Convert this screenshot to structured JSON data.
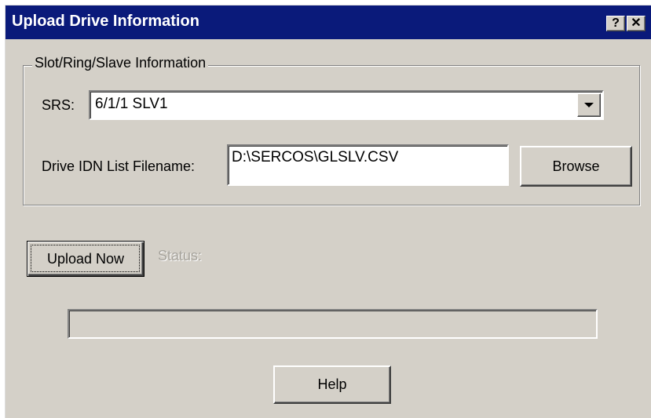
{
  "window": {
    "title": "Upload Drive Information",
    "help_caption": "?",
    "close_caption": "✕"
  },
  "group": {
    "label": "Slot/Ring/Slave Information",
    "srs_label": "SRS:",
    "srs_value": "6/1/1  SLV1",
    "filename_label": "Drive IDN List Filename:",
    "filename_value": "D:\\SERCOS\\GLSLV.CSV",
    "browse_label": "Browse"
  },
  "upload": {
    "button_label": "Upload Now",
    "status_label": "Status:",
    "progress": 0
  },
  "footer": {
    "help_label": "Help"
  },
  "colors": {
    "titlebar": "#0a1a7a",
    "face": "#d4d0c8",
    "disabled_text": "#a6a39c"
  }
}
